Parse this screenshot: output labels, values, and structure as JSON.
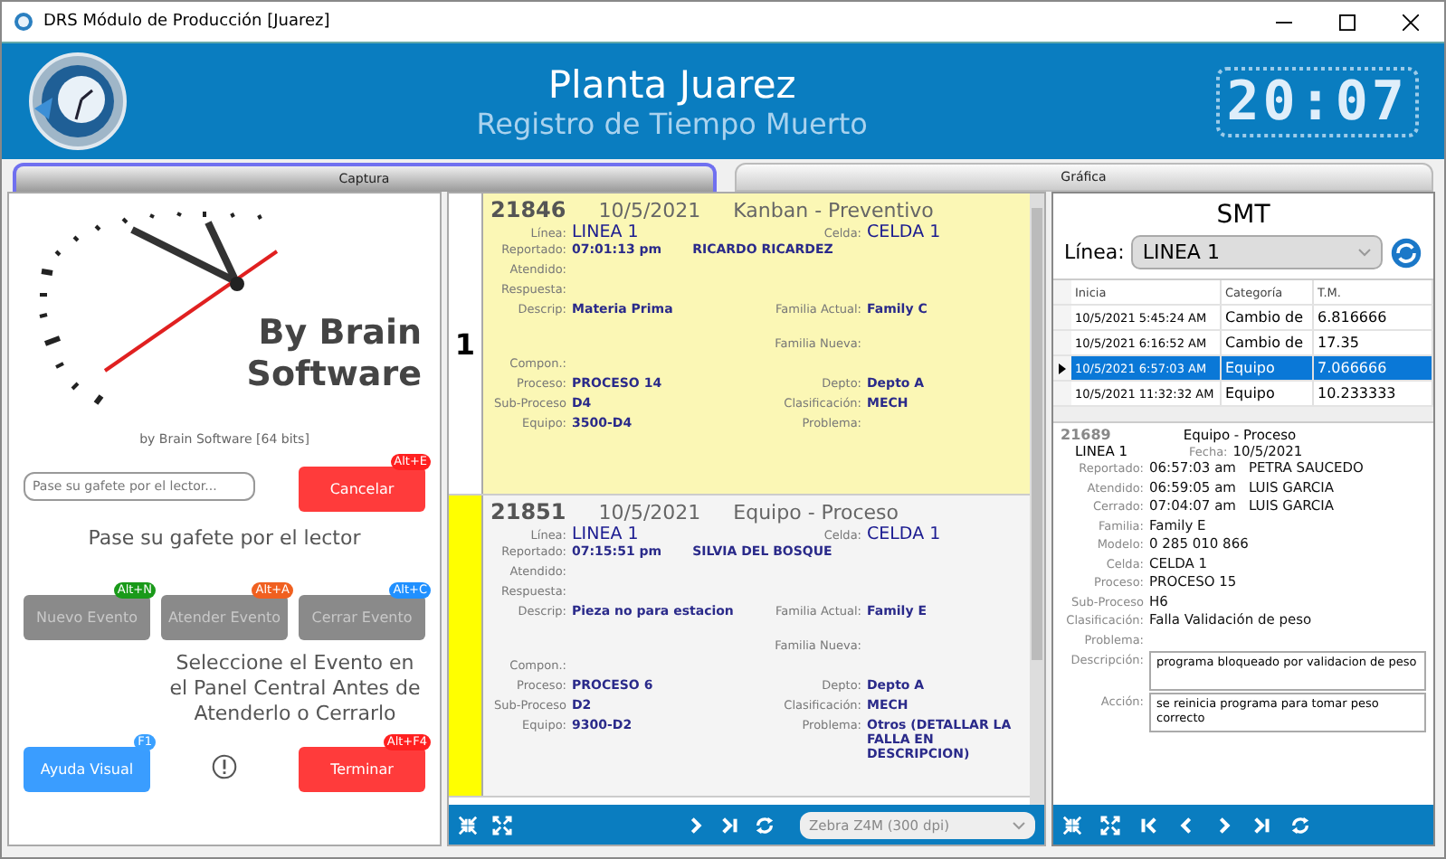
{
  "window": {
    "title": "DRS Módulo de Producción [Juarez]"
  },
  "header": {
    "plant": "Planta Juarez",
    "subtitle": "Registro de Tiempo Muerto",
    "clock": "20:07"
  },
  "tabs": [
    {
      "label": "Captura",
      "selected": true
    },
    {
      "label": "Gráfica",
      "selected": false
    }
  ],
  "left": {
    "brand": [
      "By Brain",
      "Software"
    ],
    "version": "by Brain Software [64 bits]",
    "badge_field": {
      "placeholder": "Pase su gafete por el lector..."
    },
    "status": "Pase su gafete por el lector",
    "instruction": "Seleccione el Evento en el Panel Central Antes de Atenderlo o Cerrarlo",
    "buttons": [
      {
        "label": "Cancelar",
        "shortcut": "Alt+E",
        "color": "#ff2020",
        "kind": "danger",
        "disabled": false
      },
      {
        "label": "Nuevo Evento",
        "shortcut": "Alt+N",
        "color": "#1a9a1a",
        "kind": "neutral",
        "disabled": true
      },
      {
        "label": "Atender Evento",
        "shortcut": "Alt+A",
        "color": "#f06020",
        "kind": "neutral",
        "disabled": true
      },
      {
        "label": "Cerrar Evento",
        "shortcut": "Alt+C",
        "color": "#2090ff",
        "kind": "neutral",
        "disabled": true
      },
      {
        "label": "Ayuda Visual",
        "shortcut": "F1",
        "color": "#3aa0ff",
        "kind": "help",
        "disabled": false
      },
      {
        "label": "Terminar",
        "shortcut": "Alt+F4",
        "color": "#ff2020",
        "kind": "danger",
        "disabled": false
      }
    ]
  },
  "events": [
    {
      "number": "21846",
      "date": "10/5/2021",
      "category": "Kanban - Preventivo",
      "selected": true,
      "marker": {
        "kind": "number",
        "text": "1"
      },
      "rows": [
        {
          "left": {
            "label": "Línea:",
            "value": "LINEA 1"
          },
          "right": {
            "label": "Celda:",
            "value": "CELDA 1"
          }
        },
        {
          "left": {
            "label": "Reportado:",
            "value": "07:01:13 pm",
            "extra": "RICARDO RICARDEZ"
          }
        },
        {
          "left": {
            "label": "Atendido:"
          }
        },
        {
          "left": {
            "label": "Respuesta:"
          }
        },
        {
          "left": {
            "label": "Descrip:",
            "value": "Materia Prima"
          },
          "right": {
            "label": "Familia Actual:",
            "value": "Family C"
          }
        },
        {
          "right": {
            "label": "Familia Nueva:"
          }
        },
        {
          "left": {
            "label": "Compon.:"
          }
        },
        {
          "left": {
            "label": "Proceso:",
            "value": "PROCESO 14"
          },
          "right": {
            "label": "Depto:",
            "value": "Depto A"
          }
        },
        {
          "left": {
            "label": "Sub-Proceso",
            "value": "D4"
          },
          "right": {
            "label": "Clasificación:",
            "value": "MECH"
          }
        },
        {
          "left": {
            "label": "Equipo:",
            "value": "3500-D4"
          },
          "right": {
            "label": "Problema:"
          }
        }
      ]
    },
    {
      "number": "21851",
      "date": "10/5/2021",
      "category": "Equipo - Proceso",
      "selected": false,
      "marker": {
        "kind": "color",
        "color": "#ffff00"
      },
      "rows": [
        {
          "left": {
            "label": "Línea:",
            "value": "LINEA 1"
          },
          "right": {
            "label": "Celda:",
            "value": "CELDA 1"
          }
        },
        {
          "left": {
            "label": "Reportado:",
            "value": "07:15:51 pm",
            "extra": "SILVIA DEL BOSQUE"
          }
        },
        {
          "left": {
            "label": "Atendido:"
          }
        },
        {
          "left": {
            "label": "Respuesta:"
          }
        },
        {
          "left": {
            "label": "Descrip:",
            "value": "Pieza no para estacion"
          },
          "right": {
            "label": "Familia Actual:",
            "value": "Family E"
          }
        },
        {
          "right": {
            "label": "Familia Nueva:"
          }
        },
        {
          "left": {
            "label": "Compon.:"
          }
        },
        {
          "left": {
            "label": "Proceso:",
            "value": "PROCESO 6"
          },
          "right": {
            "label": "Depto:",
            "value": "Depto A"
          }
        },
        {
          "left": {
            "label": "Sub-Proceso",
            "value": "D2"
          },
          "right": {
            "label": "Clasificación:",
            "value": "MECH"
          }
        },
        {
          "left": {
            "label": "Equipo:",
            "value": "9300-D2"
          },
          "right": {
            "label": "Problema:",
            "value": "Otros (DETALLAR LA FALLA EN DESCRIPCION)"
          }
        }
      ]
    }
  ],
  "center_toolbar": {
    "printer": "Zebra Z4M (300 dpi)"
  },
  "right": {
    "title": "SMT",
    "line_label": "Línea:",
    "line_value": "LINEA 1",
    "table": {
      "columns": [
        "Inicia",
        "Categoría",
        "T.M."
      ],
      "rows": [
        {
          "cells": [
            "10/5/2021 5:45:24 AM",
            "Cambio de",
            "6.816666"
          ],
          "selected": false
        },
        {
          "cells": [
            "10/5/2021 6:16:52 AM",
            "Cambio de",
            "17.35"
          ],
          "selected": false
        },
        {
          "cells": [
            "10/5/2021 6:57:03 AM",
            "Equipo",
            "7.066666"
          ],
          "selected": true
        },
        {
          "cells": [
            "10/5/2021 11:32:32 AM",
            "Equipo",
            "10.233333"
          ],
          "selected": false
        }
      ]
    },
    "detail": {
      "number": "21689",
      "category": "Equipo - Proceso",
      "line": "LINEA 1",
      "date_label": "Fecha:",
      "date": "10/5/2021",
      "fields": [
        {
          "label": "Reportado:",
          "value": "06:57:03 am",
          "extra": "PETRA SAUCEDO"
        },
        {
          "label": "Atendido:",
          "value": "06:59:05 am",
          "extra": "LUIS GARCIA"
        },
        {
          "label": "Cerrado:",
          "value": "07:04:07 am",
          "extra": "LUIS GARCIA"
        },
        {
          "label": "Familia:",
          "value": "Family E"
        },
        {
          "label": "Modelo:",
          "value": "0 285 010 866"
        },
        {
          "label": "Celda:",
          "value": "CELDA 1"
        },
        {
          "label": "Proceso:",
          "value": "PROCESO 15"
        },
        {
          "label": "Sub-Proceso",
          "value": "H6"
        },
        {
          "label": "Clasificación:",
          "value": "Falla Validación de peso"
        },
        {
          "label": "Problema:"
        }
      ],
      "notes": [
        {
          "label": "Descripción:",
          "value": "programa bloqueado por validacion de peso"
        },
        {
          "label": "Acción:",
          "value": "se reinicia programa para tomar peso correcto"
        }
      ]
    }
  }
}
